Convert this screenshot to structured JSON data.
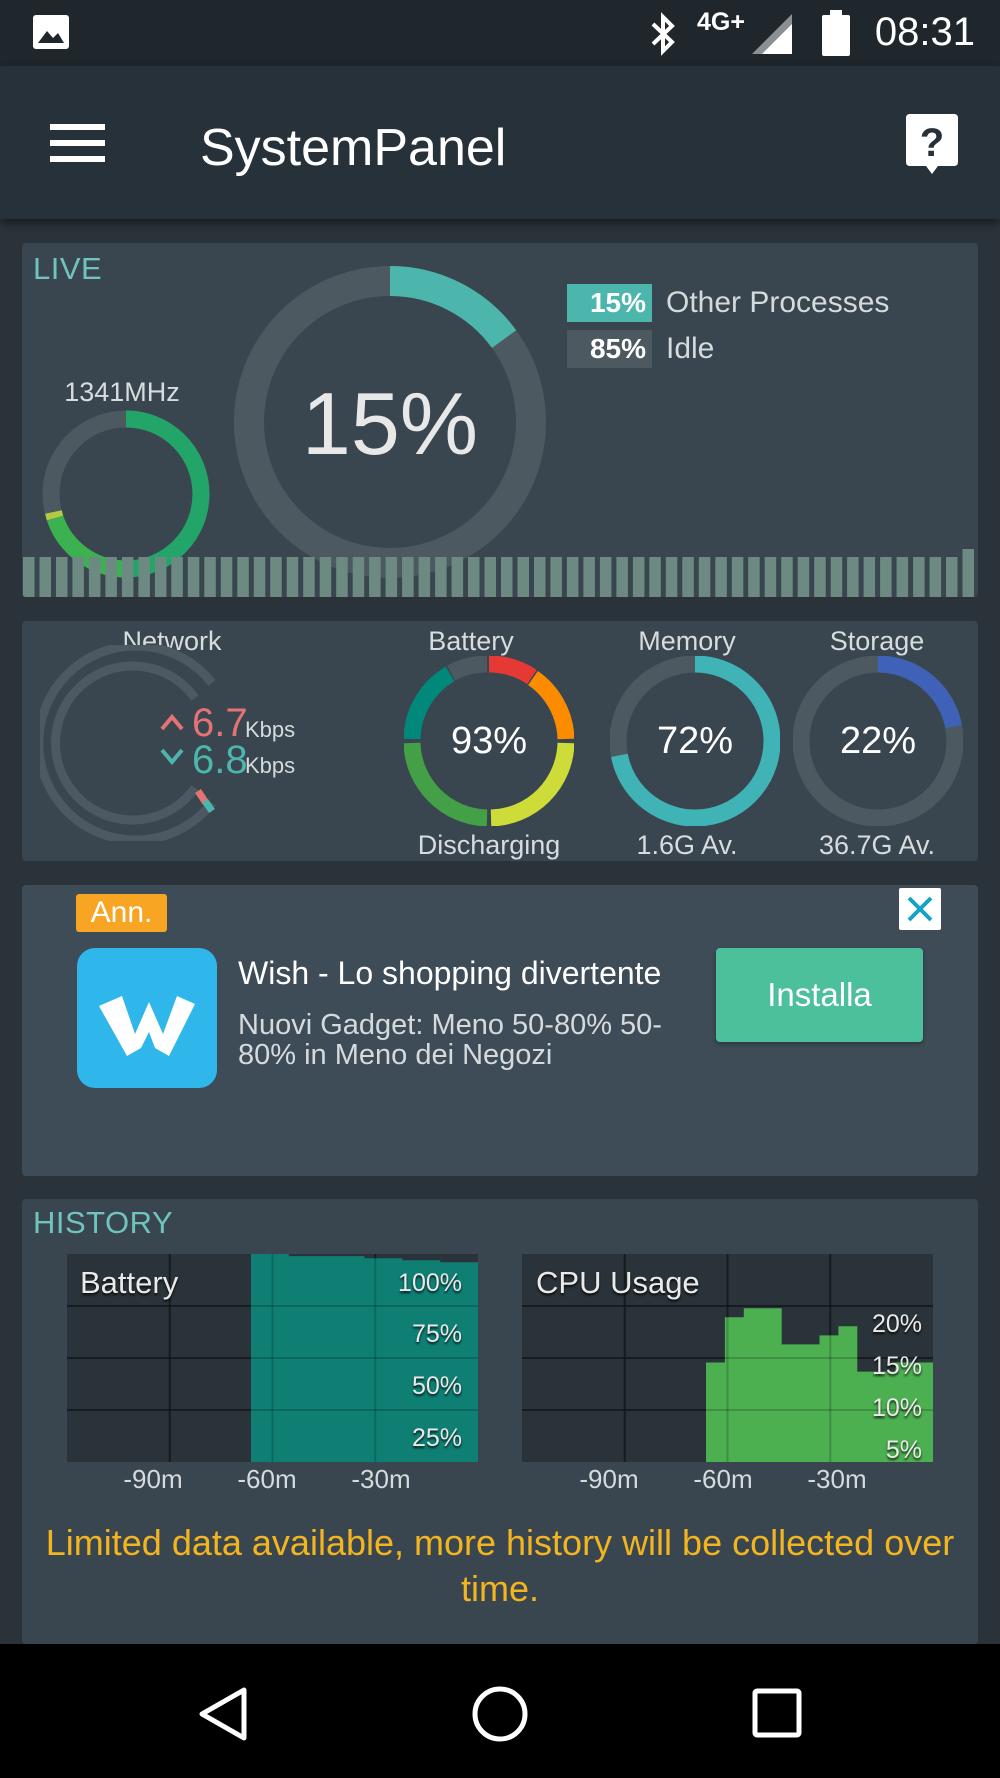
{
  "status_bar": {
    "time": "08:31",
    "network_type": "4G+",
    "icons": [
      "image-icon",
      "bluetooth-icon",
      "signal-icon",
      "battery-icon"
    ]
  },
  "app_bar": {
    "title": "SystemPanel",
    "menu_icon": "menu-icon",
    "help_icon": "help-icon"
  },
  "live": {
    "label": "LIVE",
    "cpu_freq": "1341MHz",
    "cpu_percent": "15%",
    "cpu_fraction": 0.15,
    "legend": [
      {
        "value": "15%",
        "label": "Other Processes",
        "color": "#4db6ac"
      },
      {
        "value": "85%",
        "label": "Idle",
        "color": "#4c5960"
      }
    ]
  },
  "stats": {
    "network": {
      "label": "Network",
      "up_value": "6.7",
      "up_unit": "Kbps",
      "down_value": "6.8",
      "down_unit": "Kbps"
    },
    "battery": {
      "label": "Battery",
      "value": "93%",
      "status": "Discharging"
    },
    "memory": {
      "label": "Memory",
      "value": "72%",
      "sub": "1.6G Av.",
      "fraction": 0.72
    },
    "storage": {
      "label": "Storage",
      "value": "22%",
      "sub": "36.7G Av.",
      "fraction": 0.22
    }
  },
  "ad": {
    "badge": "Ann.",
    "title": "Wish - Lo shopping divertente",
    "body": "Nuovi Gadget: Meno 50-80% 50-80% in Meno dei Negozi",
    "button": "Installa"
  },
  "history": {
    "label": "HISTORY",
    "notice": "Limited data available, more history will be collected over time.",
    "battery_chart": {
      "title": "Battery",
      "y_ticks": [
        "100%",
        "75%",
        "50%",
        "25%"
      ],
      "x_ticks": [
        "-90m",
        "-60m",
        "-30m"
      ]
    },
    "cpu_chart": {
      "title": "CPU Usage",
      "y_ticks": [
        "20%",
        "15%",
        "10%",
        "5%"
      ],
      "x_ticks": [
        "-90m",
        "-60m",
        "-30m"
      ]
    }
  },
  "chart_data": [
    {
      "type": "area",
      "title": "Battery",
      "x": [
        "-60m",
        "-50m",
        "-40m",
        "-30m",
        "-20m",
        "-10m",
        "0m"
      ],
      "values": [
        100,
        99,
        99,
        98,
        97,
        96,
        95
      ],
      "ylim": [
        0,
        100
      ],
      "color": "#0f7f74"
    },
    {
      "type": "area",
      "title": "CPU Usage",
      "x": [
        "-60m",
        "-55m",
        "-50m",
        "-45m",
        "-40m",
        "-35m",
        "-30m",
        "-25m",
        "-20m",
        "-15m",
        "-10m",
        "-5m",
        "0m"
      ],
      "values": [
        11,
        16,
        17,
        17,
        13,
        13,
        14,
        15,
        10,
        10,
        11,
        11,
        11
      ],
      "ylim": [
        0,
        23
      ],
      "color": "#4caf50"
    }
  ]
}
